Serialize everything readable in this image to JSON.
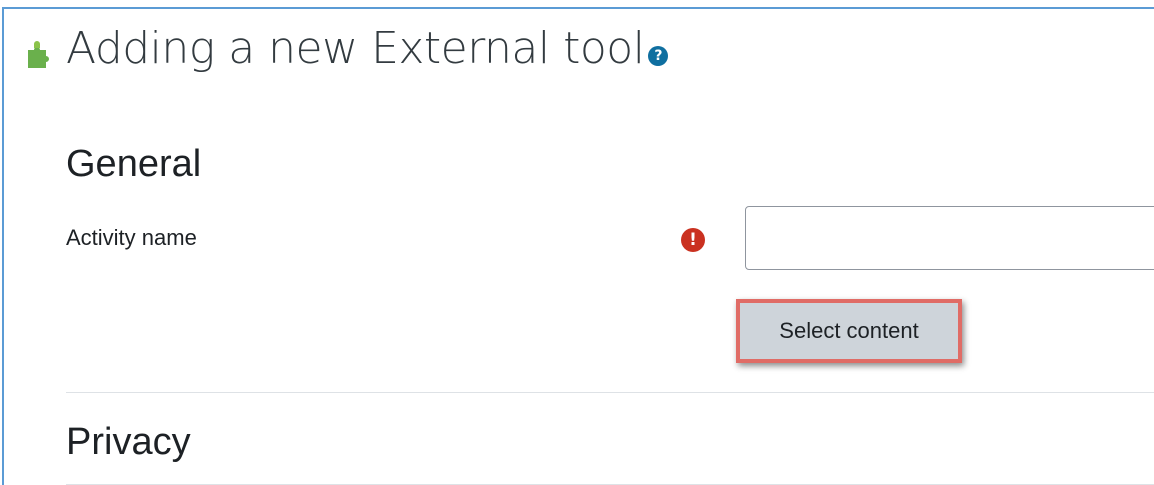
{
  "header": {
    "title": "Adding a new External tool",
    "puzzle_icon": "puzzle-icon",
    "help_icon": "help-icon",
    "help_glyph": "?"
  },
  "sections": {
    "general": {
      "title": "General",
      "activity_name_label": "Activity name",
      "activity_name_value": "",
      "required_glyph": "!",
      "select_content_label": "Select content"
    },
    "privacy": {
      "title": "Privacy"
    }
  },
  "colors": {
    "frame_border": "#5b9bd5",
    "puzzle_icon": "#6ab04c",
    "help_icon": "#0f6fa0",
    "required_icon": "#ca3120",
    "highlight_border": "#e06c66",
    "button_bg": "#ced4da"
  }
}
